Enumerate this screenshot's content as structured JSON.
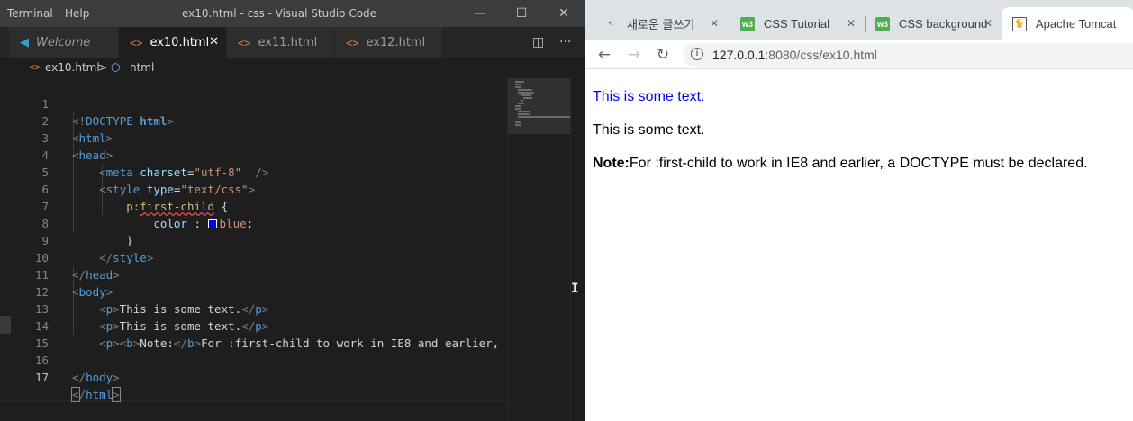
{
  "vscode": {
    "menu": [
      "Terminal",
      "Help"
    ],
    "window_title": "ex10.html - css - Visual Studio Code",
    "window_controls": {
      "minimize": "—",
      "maximize": "☐",
      "close": "✕"
    },
    "tabs": [
      {
        "label": "Welcome",
        "icon": "vscode-icon",
        "active": false
      },
      {
        "label": "ex10.html",
        "icon": "html-file-icon",
        "active": true,
        "close": "✕"
      },
      {
        "label": "ex11.html",
        "icon": "html-file-icon",
        "active": false
      },
      {
        "label": "ex12.html",
        "icon": "html-file-icon",
        "active": false
      }
    ],
    "editor_actions": {
      "split": "◫",
      "more": "···"
    },
    "breadcrumb": {
      "file": "ex10.html",
      "separator": ">",
      "symbol": "html"
    },
    "line_numbers": [
      "1",
      "2",
      "3",
      "4",
      "5",
      "6",
      "7",
      "8",
      "9",
      "10",
      "11",
      "12",
      "13",
      "14",
      "15",
      "16",
      "17"
    ],
    "code": {
      "l1_open": "<!",
      "l1_kw": "DOCTYPE",
      "l1_rest": " html",
      "l1_close": ">",
      "tag_html": "html",
      "tag_head": "head",
      "tag_meta": "meta",
      "tag_style": "style",
      "tag_body": "body",
      "tag_p": "p",
      "tag_b": "b",
      "attr_charset": "charset",
      "val_charset": "\"utf-8\"",
      "attr_type": "type",
      "val_type": "\"text/css\"",
      "eq": "=",
      "selector_prefix": "p:",
      "selector_pseudo": "first-child",
      "brace_open": " {",
      "prop": "color",
      "colon": " : ",
      "value": "blue",
      "semi": ";",
      "brace_close": "}",
      "p_text": "This is some text.",
      "note_label": "Note:",
      "note_text": "For :first-child to work in IE8 and earlier,"
    }
  },
  "chrome": {
    "tabs": [
      {
        "title": "새로운 글쓰기",
        "favicon": "dots-icon",
        "active": false
      },
      {
        "title": "CSS Tutorial",
        "favicon": "w3schools-icon",
        "active": false
      },
      {
        "title": "CSS background",
        "favicon": "w3schools-icon",
        "active": false
      },
      {
        "title": "Apache Tomcat",
        "favicon": "tomcat-icon",
        "active": true
      }
    ],
    "tab_close": "✕",
    "nav": {
      "back": "←",
      "forward": "→",
      "reload": "↻"
    },
    "address": {
      "host": "127.0.0.1",
      "path": ":8080/css/ex10.html",
      "info": "i"
    },
    "page": {
      "p1": "This is some text.",
      "p2": "This is some text.",
      "note_label": "Note:",
      "note_text": "For :first-child to work in IE8 and earlier, a DOCTYPE must be declared."
    }
  },
  "colors": {
    "first_child_text": "#0000ff",
    "vscode_accent": "#3c99d4",
    "html_icon": "#e37933"
  }
}
